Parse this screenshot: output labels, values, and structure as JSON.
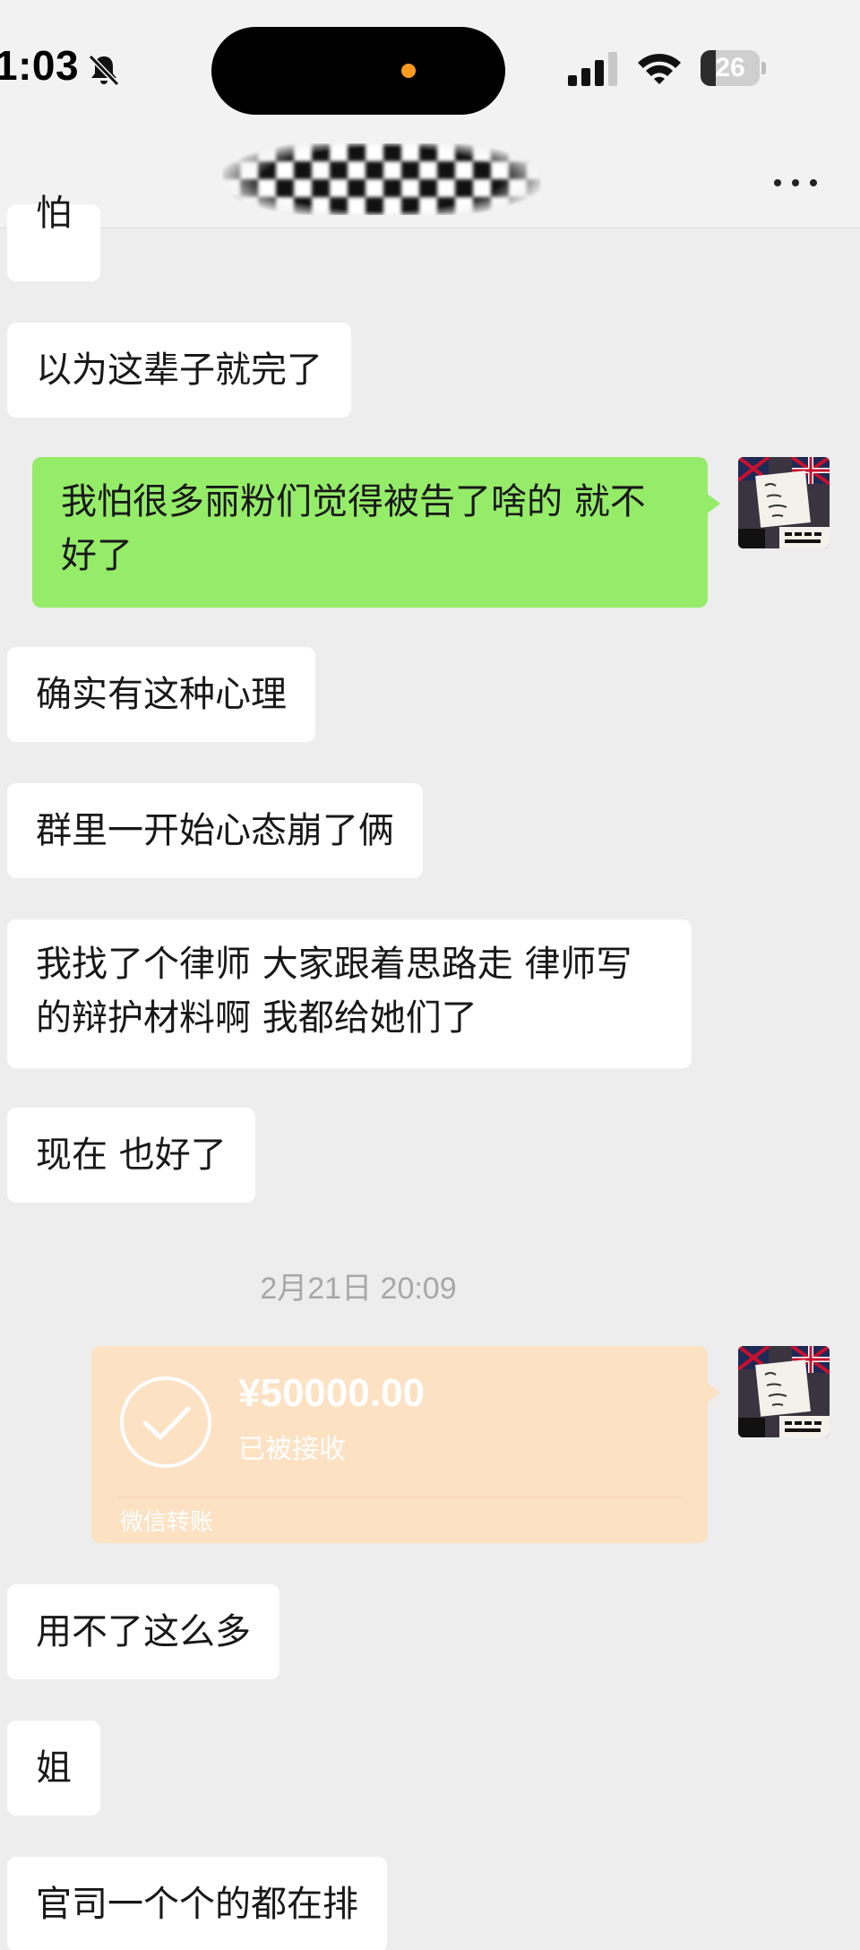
{
  "status_bar": {
    "time": "1:03",
    "battery_level": "26",
    "battery_fraction": 0.26,
    "icons": [
      "bell-muted-icon",
      "cellular-signal-icon",
      "wifi-icon",
      "battery-icon"
    ]
  },
  "header": {
    "title_censored": true,
    "more_icon": "more-dots-icon"
  },
  "messages": [
    {
      "side": "received",
      "text": "怕"
    },
    {
      "side": "received",
      "text": "以为这辈子就完了"
    },
    {
      "side": "sent",
      "text": "我怕很多丽粉们觉得被告了啥的 就不好了"
    },
    {
      "side": "received",
      "text": "确实有这种心理"
    },
    {
      "side": "received",
      "text": "群里一开始心态崩了俩"
    },
    {
      "side": "received",
      "text": "我找了个律师 大家跟着思路走 律师写的辩护材料啊 我都给她们了"
    },
    {
      "side": "received",
      "text": "现在 也好了"
    },
    {
      "side": "received",
      "text": "用不了这么多"
    },
    {
      "side": "received",
      "text": "姐"
    },
    {
      "side": "received",
      "text": "官司一个个的都在排"
    }
  ],
  "timestamp": "2月21日 20:09",
  "transfer": {
    "amount": "¥50000.00",
    "status": "已被接收",
    "label": "微信转账",
    "icon": "check-circle-icon"
  },
  "colors": {
    "background": "#ededed",
    "received_bubble": "#ffffff",
    "sent_bubble": "#95ec69",
    "transfer_card": "#fce1c3",
    "timestamp": "#a8a8a8"
  }
}
